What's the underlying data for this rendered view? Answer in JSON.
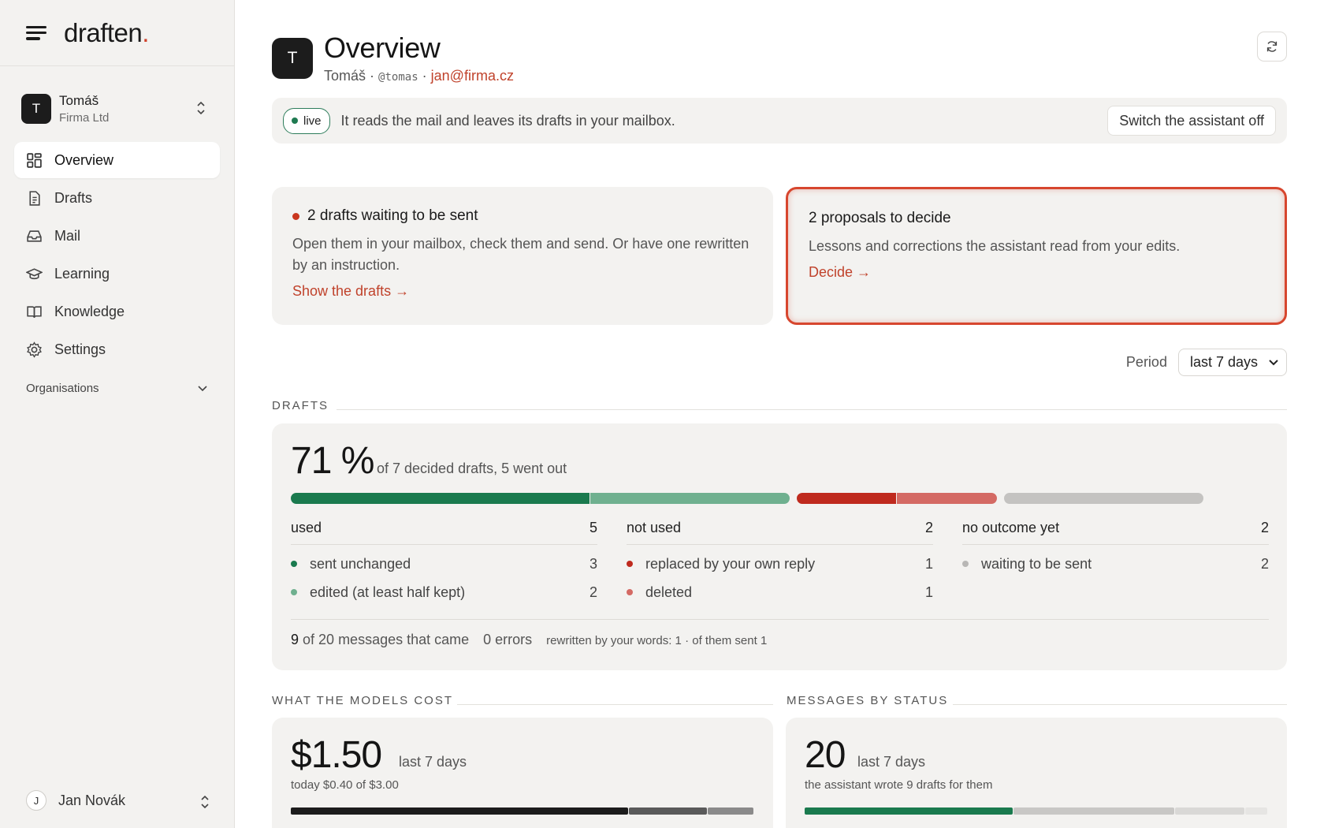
{
  "brand": {
    "name": "draften",
    "dot": "."
  },
  "account": {
    "initial": "T",
    "name": "Tomáš",
    "org": "Firma Ltd"
  },
  "nav": [
    {
      "label": "Overview",
      "icon": "grid-icon"
    },
    {
      "label": "Drafts",
      "icon": "document-icon"
    },
    {
      "label": "Mail",
      "icon": "inbox-icon"
    },
    {
      "label": "Learning",
      "icon": "graduation-cap-icon"
    },
    {
      "label": "Knowledge",
      "icon": "book-icon"
    },
    {
      "label": "Settings",
      "icon": "gear-icon"
    }
  ],
  "organisations_label": "Organisations",
  "footer_user": {
    "initial": "J",
    "name": "Jan Novák"
  },
  "header": {
    "initial": "T",
    "title": "Overview",
    "name": "Tomáš",
    "sep": "·",
    "handle": "@tomas",
    "email": "jan@firma.cz"
  },
  "banner": {
    "badge": "live",
    "text": "It reads the mail and leaves its drafts in your mailbox.",
    "button": "Switch the assistant off"
  },
  "cards": {
    "drafts": {
      "title": "2 drafts waiting to be sent",
      "desc": "Open them in your mailbox, check them and send. Or have one rewritten by an instruction.",
      "link": "Show the drafts →"
    },
    "proposals": {
      "title": "2 proposals to decide",
      "desc": "Lessons and corrections the assistant read from your edits.",
      "link": "Decide →"
    }
  },
  "period": {
    "label": "Period",
    "value": "last 7 days"
  },
  "drafts_section": {
    "label": "DRAFTS",
    "percent": "71 %",
    "percent_value": 71,
    "summary": "of 7 decided drafts, 5 went out",
    "bar": [
      {
        "key": "sent_unchanged",
        "value": 3,
        "color": "#1a7a4e"
      },
      {
        "key": "edited",
        "value": 2,
        "color": "#6fb08f"
      },
      {
        "key": "replaced",
        "value": 1,
        "color": "#bf2a1e"
      },
      {
        "key": "deleted",
        "value": 1,
        "color": "#d46a64"
      },
      {
        "key": "waiting",
        "value": 2,
        "color": "#c4c3c1"
      }
    ],
    "columns": [
      {
        "head": "used",
        "count": "5",
        "rows": [
          {
            "label": "sent unchanged",
            "count": "3",
            "color": "#1a7a4e"
          },
          {
            "label": "edited (at least half kept)",
            "count": "2",
            "color": "#6fb08f"
          }
        ]
      },
      {
        "head": "not used",
        "count": "2",
        "rows": [
          {
            "label": "replaced by your own reply",
            "count": "1",
            "color": "#bf2a1e"
          },
          {
            "label": "deleted",
            "count": "1",
            "color": "#d46a64"
          }
        ]
      },
      {
        "head": "no outcome yet",
        "count": "2",
        "rows": [
          {
            "label": "waiting to be sent",
            "count": "2",
            "color": "#b8b7b5"
          }
        ]
      }
    ],
    "footer": {
      "messages_n": "9",
      "messages_text": "of 20 messages that came",
      "errors": "0 errors",
      "rewritten": "rewritten by your words: 1 · of them sent 1"
    }
  },
  "cost_section": {
    "label": "WHAT THE MODELS COST",
    "amount": "$1.50",
    "period": "last 7 days",
    "today": "today $0.40 of $3.00",
    "bar": [
      {
        "value": 0.73,
        "color": "#1c1c1c"
      },
      {
        "value": 0.17,
        "color": "#5a5a5a"
      },
      {
        "value": 0.1,
        "color": "#8a8a8a"
      }
    ]
  },
  "status_section": {
    "label": "MESSAGES BY STATUS",
    "count": "20",
    "period": "last 7 days",
    "note": "the assistant wrote 9 drafts for them",
    "bar": [
      {
        "value": 0.45,
        "color": "#1a7a4e"
      },
      {
        "value": 0.35,
        "color": "#c8c7c5"
      },
      {
        "value": 0.15,
        "color": "#d9d8d6"
      },
      {
        "value": 0.05,
        "color": "#e6e5e3"
      }
    ]
  }
}
